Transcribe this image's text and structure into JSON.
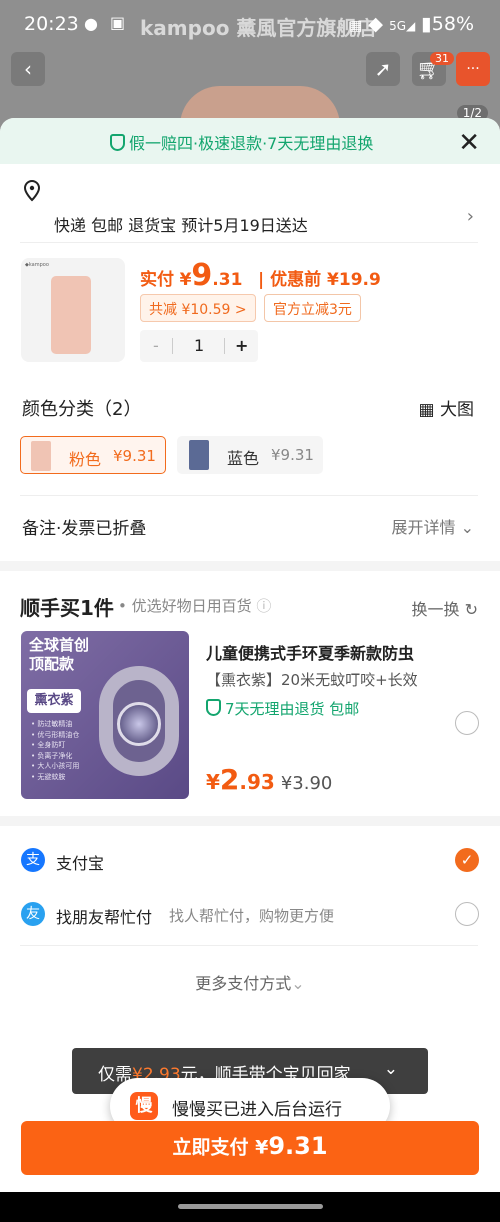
{
  "status_bar": {
    "time": "20:23",
    "battery": "58%",
    "icons": [
      "wechat-icon",
      "notify-icon",
      "nfc-icon",
      "wifi-icon",
      "signal-icon",
      "battery-icon"
    ]
  },
  "header": {
    "shop_name": "kampoo 薰風官方旗舰店",
    "cart_count": "31",
    "page_indicator": "1/2",
    "more_glyph": "···"
  },
  "banner": {
    "text": "假一赔四·极速退款·7天无理由退换"
  },
  "delivery": {
    "text": "快递 包邮 退货宝 预计5月19日送达"
  },
  "product": {
    "actual_label": "实付",
    "currency": "¥",
    "price_int": "9",
    "price_dec": ".31",
    "original_label": "| 优惠前 ¥19.9",
    "discount_tag": "共减 ¥10.59 >",
    "official_tag": "官方立减3元",
    "qty": "1",
    "minus": "-",
    "plus": "+"
  },
  "variants": {
    "title": "颜色分类（2）",
    "big_image": "大图",
    "items": [
      {
        "label": "粉色",
        "price": "¥9.31",
        "selected": true
      },
      {
        "label": "蓝色",
        "price": "¥9.31",
        "selected": false
      }
    ]
  },
  "note": {
    "label": "备注·发票已折叠",
    "expand": "展开详情"
  },
  "shunshou": {
    "title": "顺手买1件",
    "subtitle": "• 优选好物日用百货",
    "swap": "换一换",
    "item": {
      "img_headline_1": "全球首创",
      "img_headline_2": "顶配款",
      "img_badge": "熏衣紫",
      "img_features": [
        "• 防过敏精油",
        "• 优弓形精油仓",
        "• 全身防叮",
        "• 负离子净化",
        "• 大人小孩可用",
        "• 无避蚊胺"
      ],
      "title": "儿童便携式手环夏季新款防虫",
      "spec": "【熏衣紫】20米无蚊叮咬+长效",
      "tags": "7天无理由退货  包邮",
      "currency": "¥",
      "price_big": "2",
      "price_dec": ".93",
      "orig_price": "¥3.90"
    }
  },
  "payment": {
    "methods": [
      {
        "label": "支付宝",
        "sub": "",
        "selected": true,
        "icon": "alipay-icon"
      },
      {
        "label": "找朋友帮忙付",
        "sub": "找人帮忙付，购物更方便",
        "selected": false,
        "icon": "friend-pay-icon"
      }
    ],
    "more": "更多支付方式"
  },
  "promo": {
    "prefix": "仅需",
    "amount": "¥2.93",
    "suffix": "元，顺手带个宝贝回家"
  },
  "toast": {
    "icon_char": "慢",
    "text": "慢慢买已进入后台运行"
  },
  "pay_button": {
    "label": "立即支付 ¥",
    "amount": "9.31"
  },
  "colors": {
    "accent": "#fb6314",
    "green": "#13a56e",
    "alipay": "#1677ff"
  }
}
